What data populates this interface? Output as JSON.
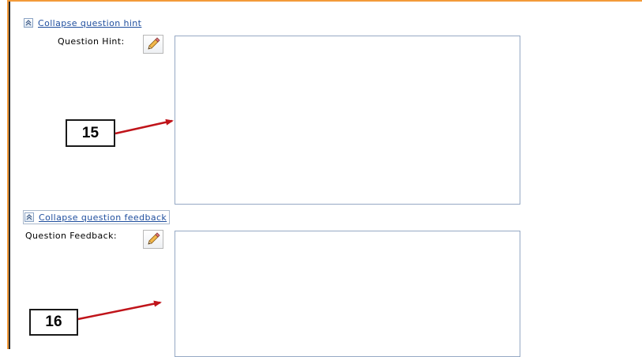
{
  "hint_section": {
    "collapse_link": "Collapse question hint",
    "label": "Question Hint:",
    "textarea_value": "",
    "callout_number": "15"
  },
  "feedback_section": {
    "collapse_link": "Collapse question feedback",
    "label": "Question Feedback:",
    "textarea_value": "",
    "callout_number": "16"
  },
  "icons": {
    "collapse": "double-chevron-up-icon",
    "edit": "pencil-icon"
  },
  "colors": {
    "frame_border": "#f39a39",
    "link": "#1f4e9e",
    "arrow": "#c0141a",
    "textarea_border": "#96a9c4"
  }
}
